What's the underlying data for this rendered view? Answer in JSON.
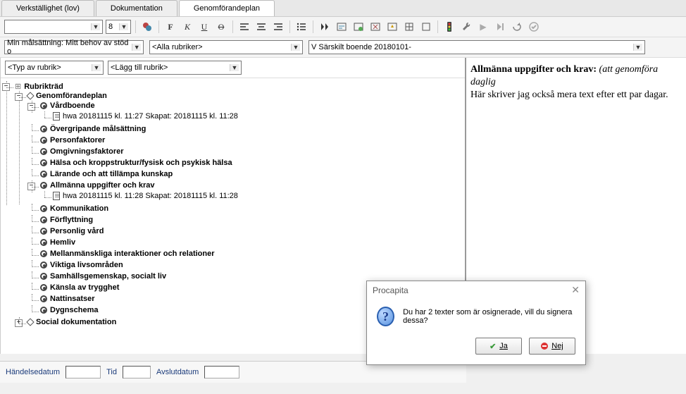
{
  "tabs": [
    "Verkställighet (lov)",
    "Dokumentation",
    "Genomförandeplan"
  ],
  "active_tab": 2,
  "toolbar": {
    "font_size": "8",
    "bold": "F",
    "italic": "K",
    "underline": "U",
    "strike": "O"
  },
  "filters": {
    "goal": "Min målsättning: Mitt behov av stöd o",
    "headings": "<Alla rubriker>",
    "period": "V Särskilt boende 20180101-"
  },
  "rubric": {
    "type_placeholder": "<Typ av rubrik>",
    "add_placeholder": "<Lägg till rubrik>"
  },
  "tree": {
    "root": "Rubrikträd",
    "plan": "Genomförandeplan",
    "vardboende": "Vårdboende",
    "vardboende_leaf": "hwa 20181115 kl. 11:27  Skapat: 20181115 kl. 11:28",
    "items": [
      "Övergripande målsättning",
      "Personfaktorer",
      "Omgivningsfaktorer",
      "Hälsa och kroppstruktur/fysisk och psykisk hälsa",
      "Lärande och att tillämpa kunskap"
    ],
    "allm": "Allmänna uppgifter och krav",
    "allm_leaf": "hwa 20181115 kl. 11:28  Skapat: 20181115 kl. 11:28",
    "items2": [
      "Kommunikation",
      "Förflyttning",
      "Personlig vård",
      "Hemliv",
      "Mellanmänskliga interaktioner och relationer",
      "Viktiga livsområden",
      "Samhällsgemenskap, socialt liv",
      "Känsla av trygghet",
      "Nattinsatser",
      "Dygnschema"
    ],
    "social": "Social dokumentation"
  },
  "content": {
    "heading": "Allmänna uppgifter och krav:",
    "hint": "(att genomföra daglig",
    "body": "Här skriver jag också mera text efter ett par dagar."
  },
  "bottom": {
    "handelsedatum": "Händelsedatum",
    "tid": "Tid",
    "avslutdatum": "Avslutdatum"
  },
  "dialog": {
    "title": "Procapita",
    "message": "Du har 2 texter som är osignerade, vill du signera dessa?",
    "yes": "Ja",
    "no": "Nej"
  }
}
